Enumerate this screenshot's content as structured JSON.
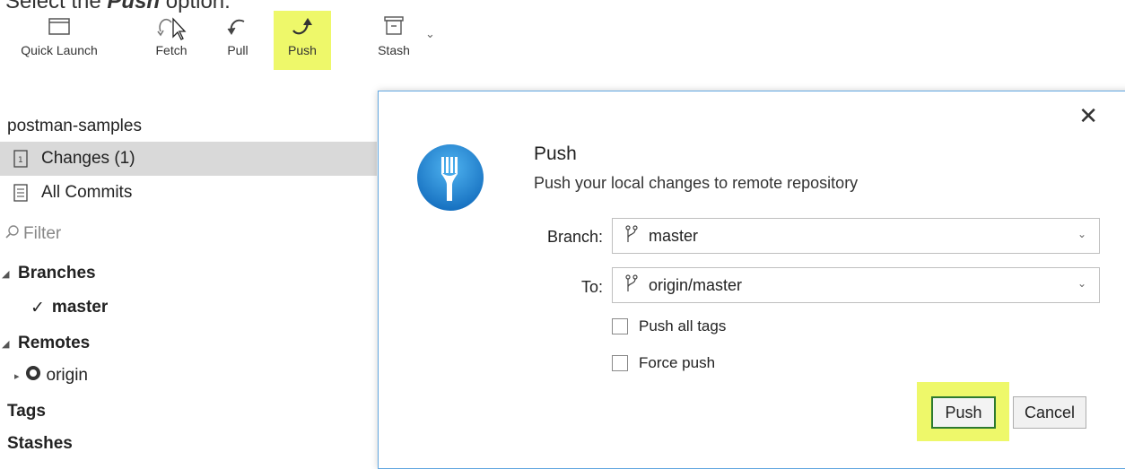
{
  "caption": {
    "prefix": "Select the ",
    "bold": "Push",
    "suffix": " option."
  },
  "toolbar": {
    "quick_launch": "Quick Launch",
    "fetch": "Fetch",
    "pull": "Pull",
    "push": "Push",
    "stash": "Stash",
    "highlight_color": "#eef86a"
  },
  "sidebar": {
    "repo": "postman-samples",
    "changes": "Changes (1)",
    "all_commits": "All Commits",
    "filter_placeholder": "Filter",
    "branches": "Branches",
    "current_branch": "master",
    "remotes": "Remotes",
    "remote_origin": "origin",
    "tags": "Tags",
    "stashes": "Stashes"
  },
  "dialog": {
    "title": "Push",
    "subtitle": "Push your local changes to remote repository",
    "branch_label": "Branch:",
    "branch_value": "master",
    "to_label": "To:",
    "to_value": "origin/master",
    "push_all_tags": "Push all tags",
    "force_push": "Force push",
    "push_button": "Push",
    "cancel_button": "Cancel",
    "accent_color": "#1e88d6"
  }
}
